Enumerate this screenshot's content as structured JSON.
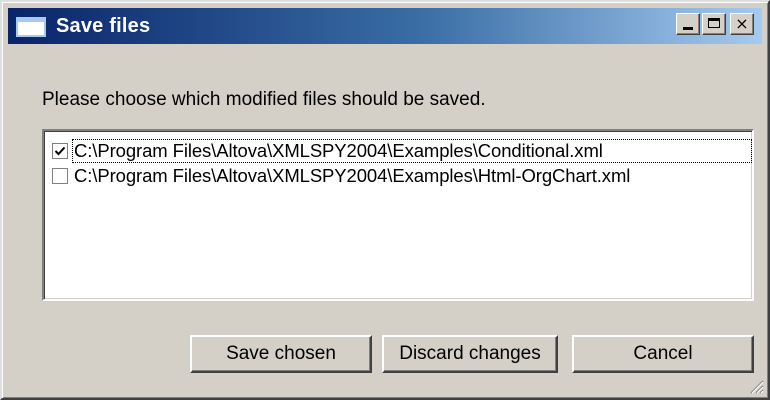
{
  "window": {
    "title": "Save files",
    "controls": {
      "minimize_icon": "minimize-icon",
      "maximize_icon": "maximize-icon",
      "close_glyph": "×"
    }
  },
  "prompt": "Please choose which modified files should be saved.",
  "files": [
    {
      "path": "C:\\Program Files\\Altova\\XMLSPY2004\\Examples\\Conditional.xml",
      "checked": true
    },
    {
      "path": "C:\\Program Files\\Altova\\XMLSPY2004\\Examples\\Html-OrgChart.xml",
      "checked": false
    }
  ],
  "buttons": {
    "save": "Save chosen",
    "discard": "Discard changes",
    "cancel": "Cancel"
  },
  "colors": {
    "title_start": "#0a246a",
    "title_end": "#a6caf0",
    "face": "#d4d0c8"
  }
}
